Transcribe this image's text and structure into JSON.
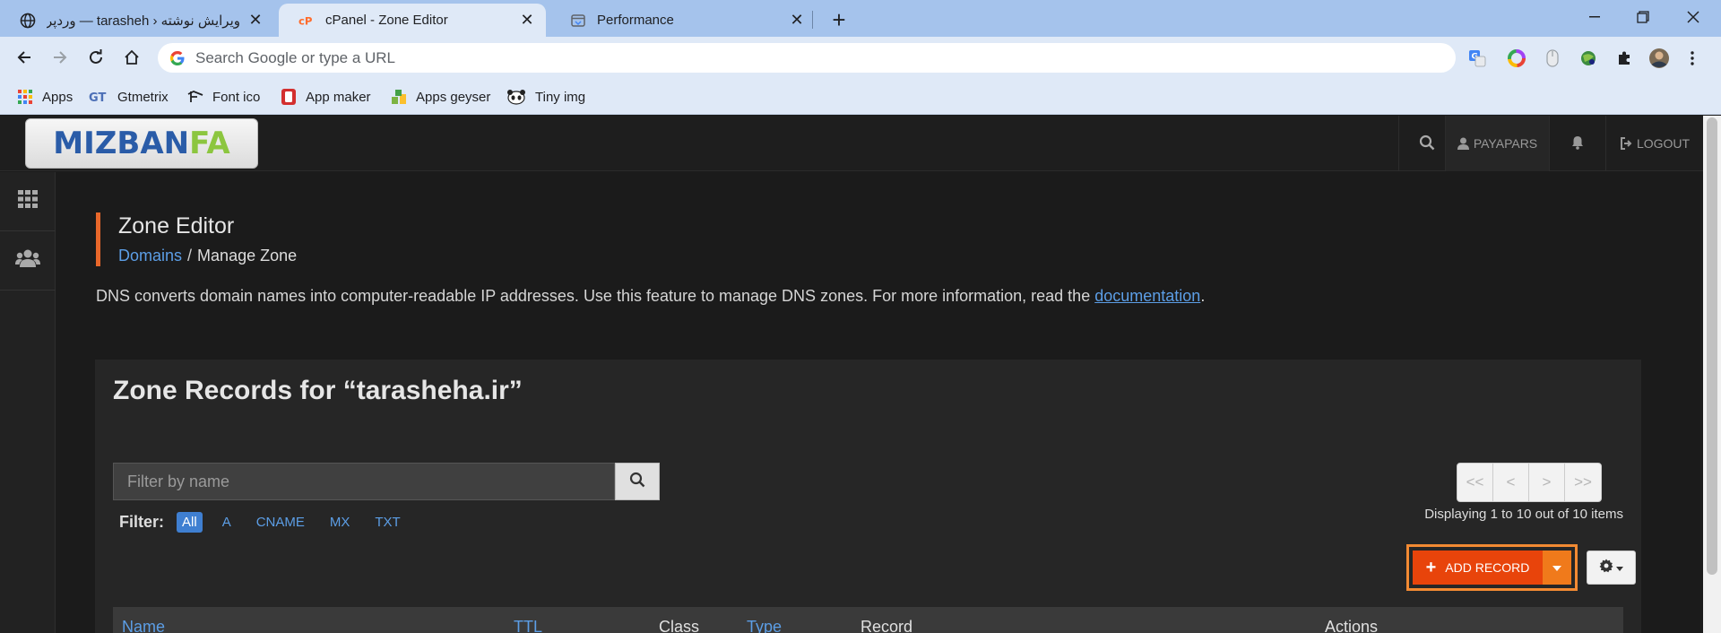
{
  "browser": {
    "tabs": [
      {
        "title": "ویرایش نوشته ‹ tarasheh — وردپرس",
        "icon": "globe-icon"
      },
      {
        "title": "cPanel - Zone Editor",
        "icon": "cpanel-icon"
      },
      {
        "title": "Performance",
        "icon": "performance-icon"
      }
    ],
    "omnibox_placeholder": "Search Google or type a URL",
    "bookmarks": [
      {
        "label": "Apps",
        "icon": "apps-grid-icon"
      },
      {
        "label": "Gtmetrix",
        "icon": "gtmetrix-icon"
      },
      {
        "label": "Font ico",
        "icon": "fontico-icon"
      },
      {
        "label": "App maker",
        "icon": "appmaker-icon"
      },
      {
        "label": "Apps geyser",
        "icon": "appsgeyser-icon"
      },
      {
        "label": "Tiny img",
        "icon": "panda-icon"
      }
    ]
  },
  "cpanel": {
    "logo": {
      "part1": "MIZBAN",
      "part2": "FA"
    },
    "user": "PAYAPARS",
    "logout": "LOGOUT",
    "page_title": "Zone Editor",
    "breadcrumb": {
      "parent": "Domains",
      "current": "Manage Zone"
    },
    "description_prefix": "DNS converts domain names into computer-readable IP addresses. Use this feature to manage DNS zones. For more information, read the ",
    "description_link": "documentation",
    "description_suffix": ".",
    "zone_title": "Zone Records for “tarasheha.ir”",
    "filter_placeholder": "Filter by name",
    "filter_label": "Filter:",
    "filters": [
      "All",
      "A",
      "CNAME",
      "MX",
      "TXT"
    ],
    "pager": [
      "<<",
      "<",
      ">",
      ">>"
    ],
    "displaying": "Displaying 1 to 10 out of 10 items",
    "add_record": "ADD RECORD",
    "columns": [
      "Name",
      "TTL",
      "Class",
      "Type",
      "Record",
      "Actions"
    ],
    "colors": {
      "accent": "#e8440b",
      "link": "#5c9ee6",
      "highlight": "#f28a33"
    }
  }
}
